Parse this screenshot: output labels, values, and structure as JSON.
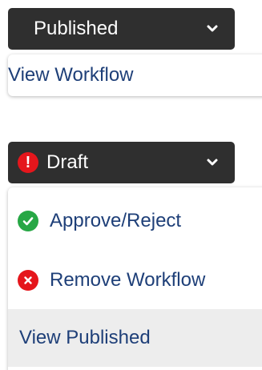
{
  "published_control": {
    "status_label": "Published",
    "menu": {
      "items": [
        {
          "label": "View Workflow"
        }
      ]
    }
  },
  "draft_control": {
    "status_label": "Draft",
    "status_icon_glyph": "!",
    "menu": {
      "items": [
        {
          "label": "Approve/Reject",
          "icon": "check-circle-icon"
        },
        {
          "label": "Remove Workflow",
          "icon": "x-circle-icon"
        },
        {
          "label": "View Published"
        }
      ]
    }
  },
  "colors": {
    "button_bg": "#2f2f2f",
    "button_text": "#ffffff",
    "link_text": "#1e3f78",
    "warning_red": "#e5161c",
    "success_green": "#27a745",
    "menu_highlight": "#ededed"
  }
}
